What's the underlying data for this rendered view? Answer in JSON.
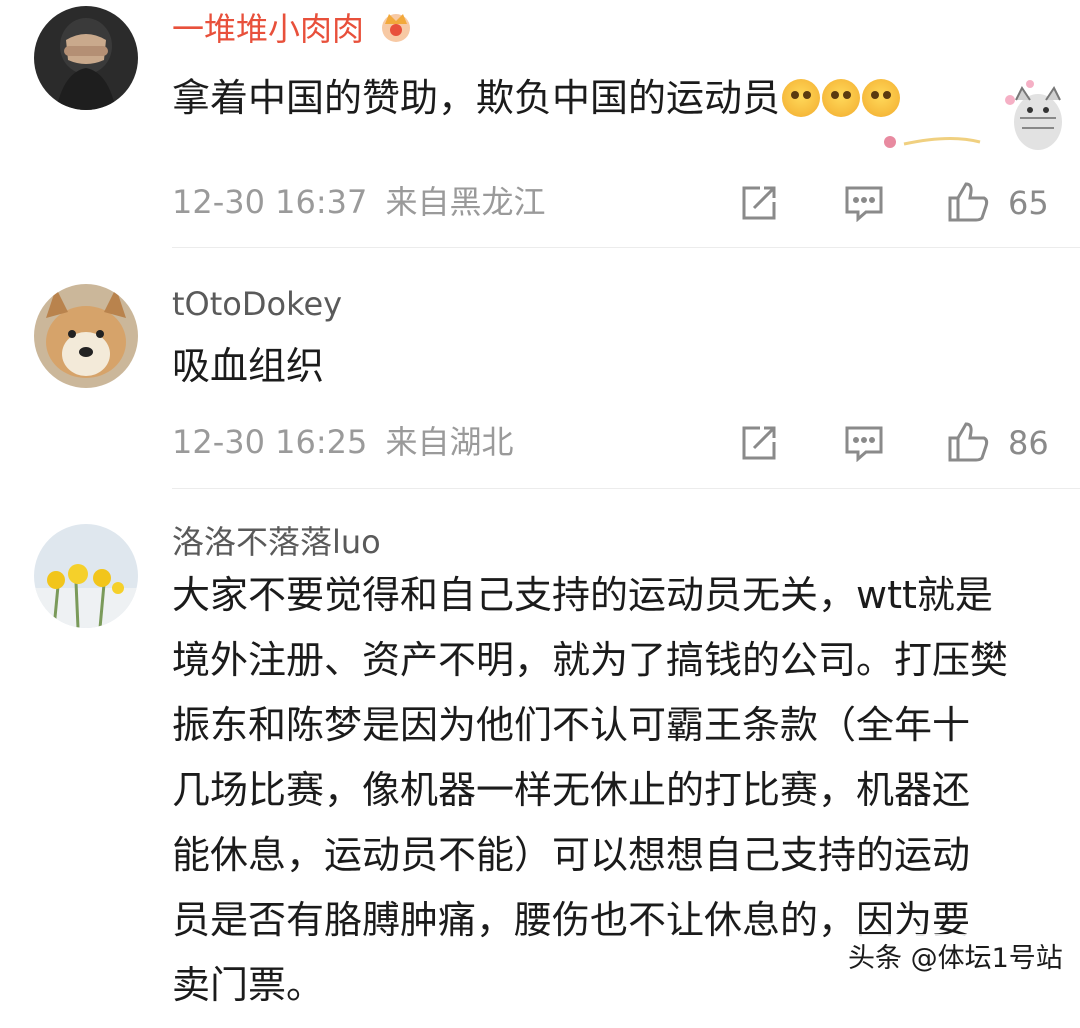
{
  "comments": [
    {
      "username": "一堆堆小肉肉",
      "text": "拿着中国的赞助，欺负中国的运动员",
      "emoji_icons": [
        "astonished-face-icon",
        "astonished-face-icon",
        "astonished-face-icon"
      ],
      "time": "12-30 16:37",
      "location": "来自黑龙江",
      "likes": "65"
    },
    {
      "username": "tOtoDokey",
      "text": "吸血组织",
      "time": "12-30 16:25",
      "location": "来自湖北",
      "likes": "86"
    },
    {
      "username": "洛洛不落落luo",
      "lines": [
        "大家不要觉得和自己支持的运动员无关，wtt就是",
        "境外注册、资产不明，就为了搞钱的公司。打压樊",
        "振东和陈梦是因为他们不认可霸王条款（全年十",
        "几场比赛，像机器一样无休止的打比赛，机器还",
        "能休息，运动员不能）可以想想自己支持的运动",
        "员是否有胳膊肿痛，腰伤也不让休息的，因为要",
        "卖门票。"
      ]
    }
  ],
  "watermark": "头条 @体坛1号站",
  "colors": {
    "vip_name": "#e8503b",
    "name": "#5a5a5a",
    "meta": "#9a9a9a",
    "text": "#1b1b1b"
  }
}
